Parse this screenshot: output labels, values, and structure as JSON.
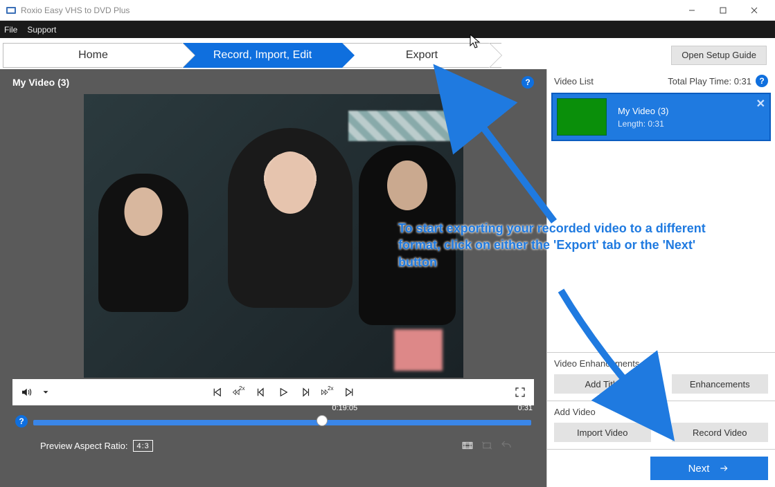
{
  "app": {
    "title": "Roxio Easy VHS to DVD Plus"
  },
  "menu": {
    "file": "File",
    "support": "Support"
  },
  "steps": {
    "home": "Home",
    "record": "Record, Import, Edit",
    "export": "Export"
  },
  "setup_guide": "Open Setup Guide",
  "left": {
    "title": "My Video (3)",
    "timeline_pos": "0:19:05",
    "timeline_end": "0:31",
    "aspect_label": "Preview Aspect Ratio:",
    "aspect_value": "4:3"
  },
  "right": {
    "list_header": "Video List",
    "tpt_label": "Total Play Time:",
    "tpt_value": "0:31",
    "item": {
      "title": "My Video (3)",
      "length_label": "Length:",
      "length_value": "0:31"
    },
    "enh_title": "Video Enhancements",
    "add_title_btn": "Add Title",
    "enh_btn": "Enhancements",
    "addvid_title": "Add Video",
    "import_btn": "Import Video",
    "record_btn": "Record Video",
    "next_btn": "Next"
  },
  "annotation": "To start exporting your recorded video to a different format, click on either the 'Export' tab or the 'Next' button"
}
